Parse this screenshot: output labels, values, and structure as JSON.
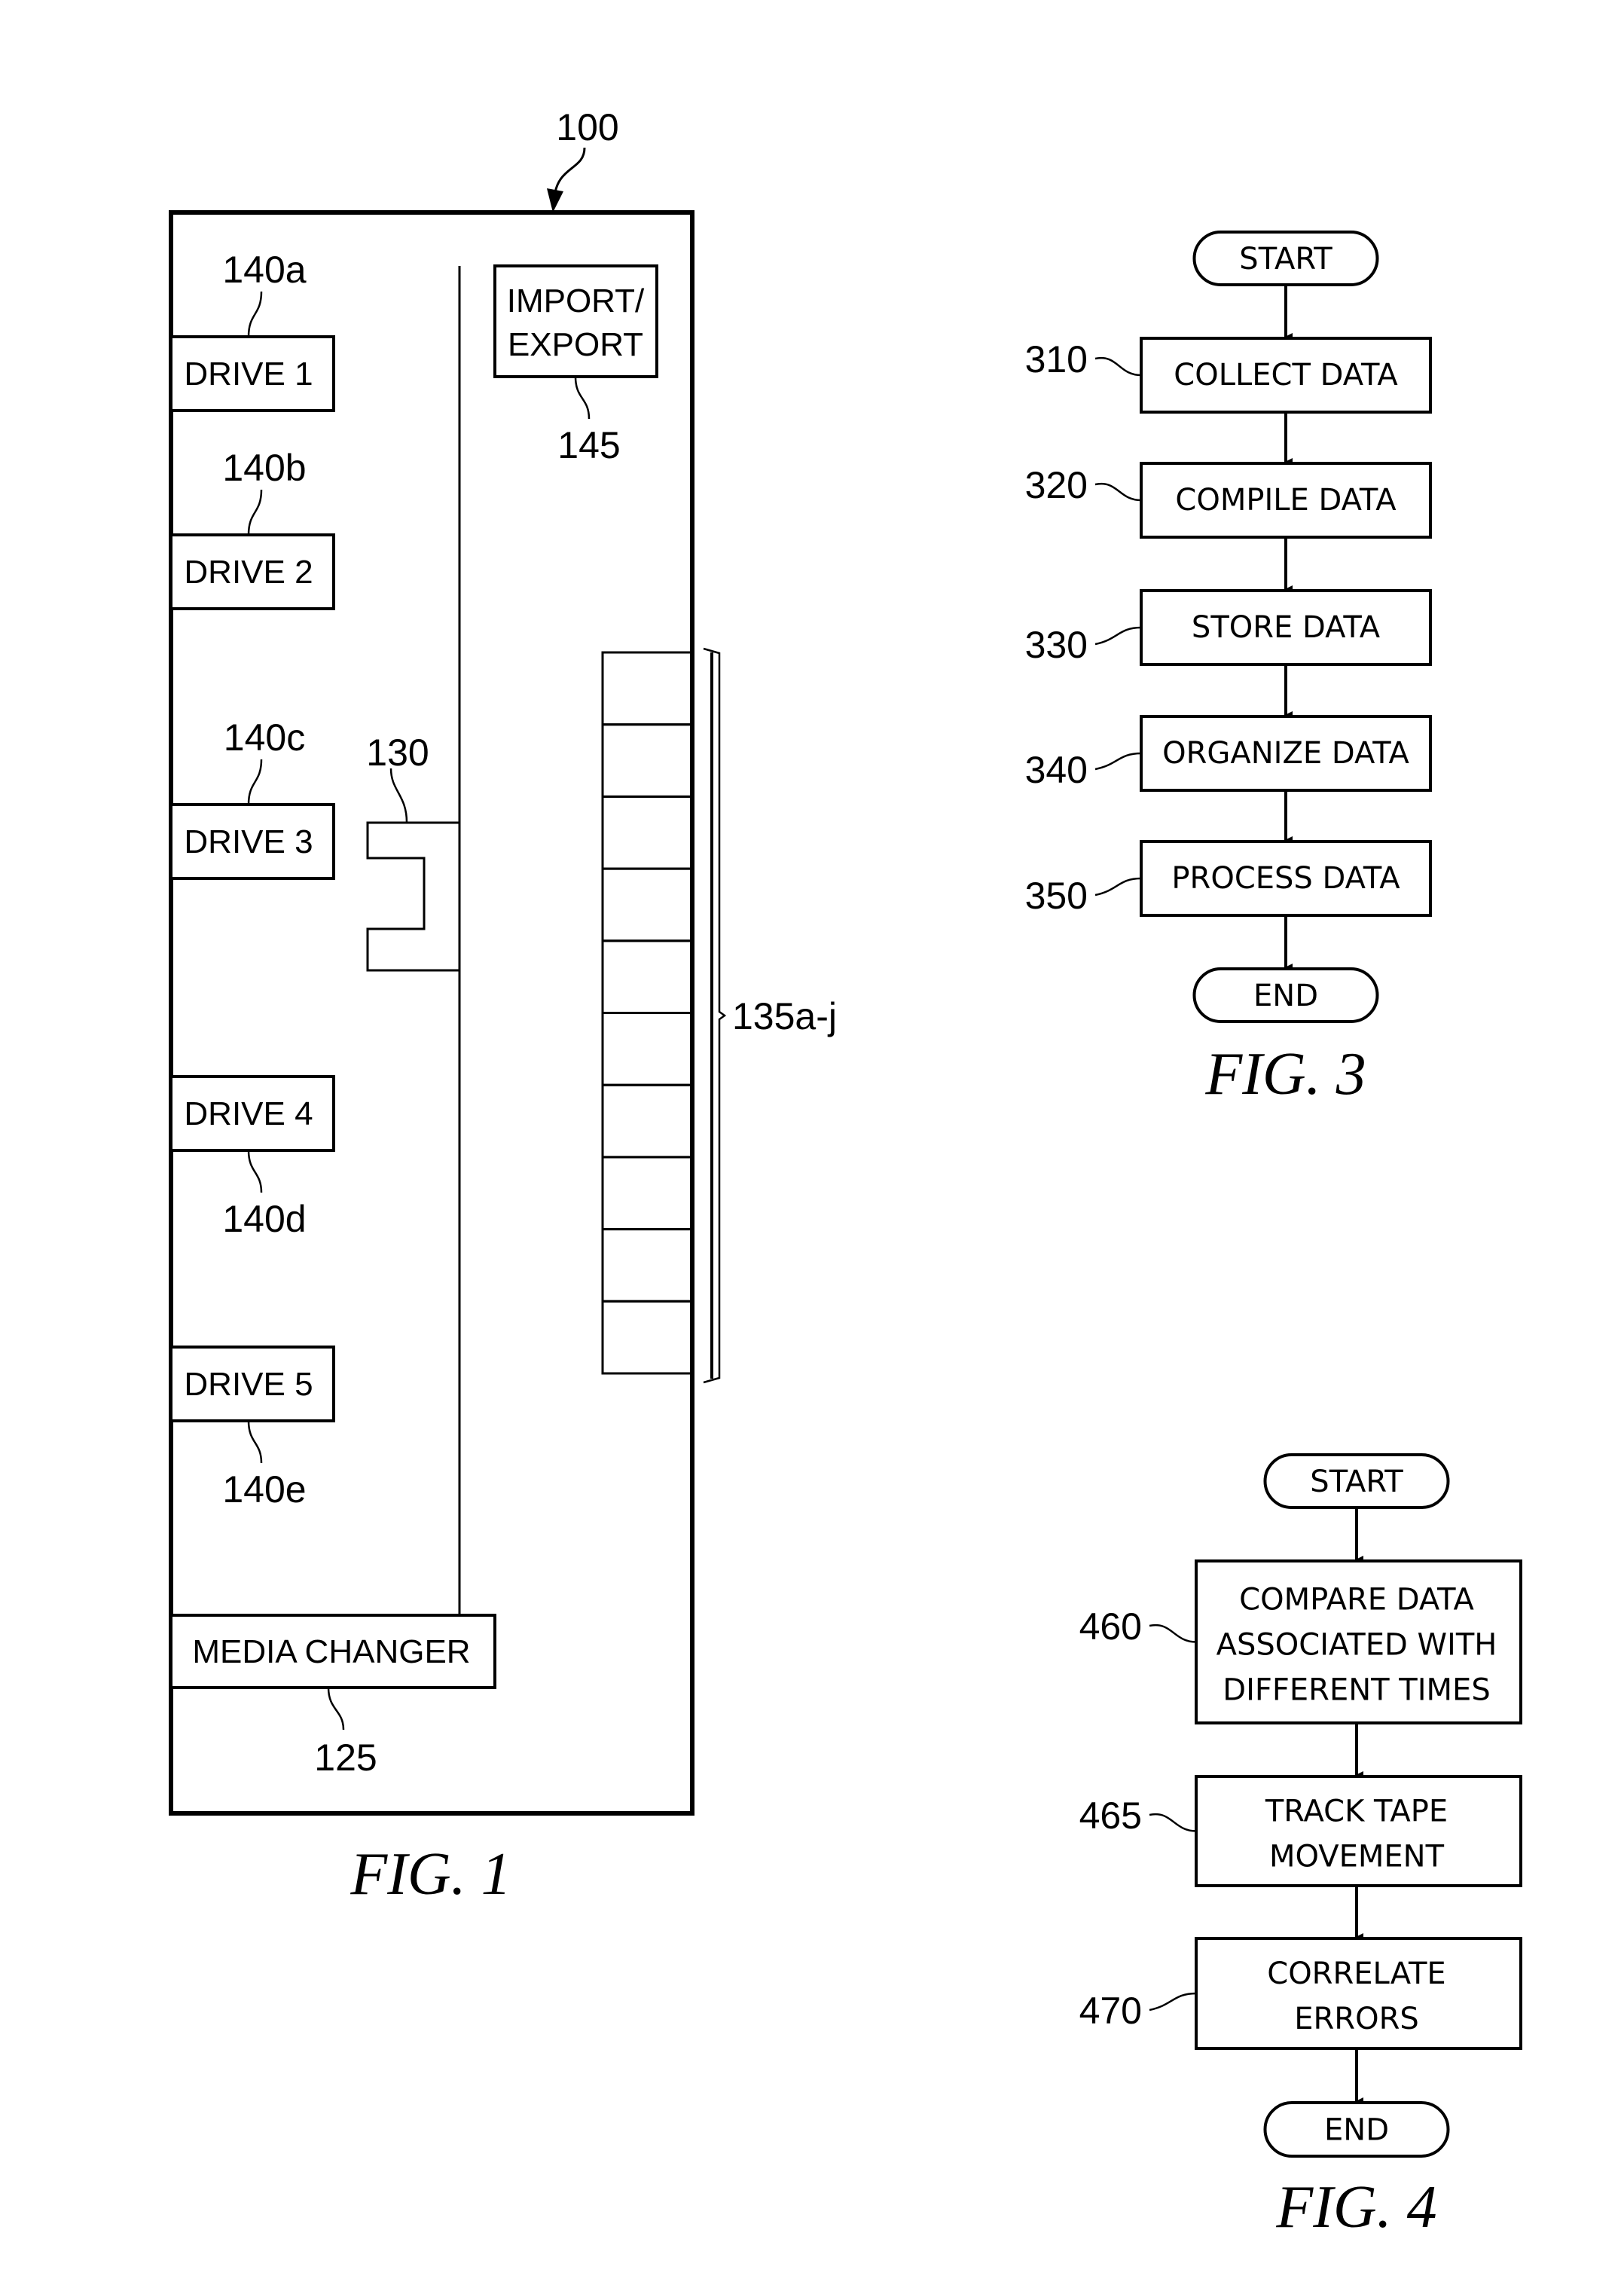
{
  "figure1": {
    "caption": "FIG. 1",
    "system_ref": "100",
    "drives": [
      {
        "label": "DRIVE 1",
        "ref": "140a",
        "ref_position": "above"
      },
      {
        "label": "DRIVE 2",
        "ref": "140b",
        "ref_position": "above"
      },
      {
        "label": "DRIVE 3",
        "ref": "140c",
        "ref_position": "above"
      },
      {
        "label": "DRIVE 4",
        "ref": "140d",
        "ref_position": "below"
      },
      {
        "label": "DRIVE 5",
        "ref": "140e",
        "ref_position": "below"
      }
    ],
    "import_export": {
      "line1": "IMPORT/",
      "line2": "EXPORT",
      "ref": "145"
    },
    "picker_ref": "130",
    "media_changer": {
      "label": "MEDIA CHANGER",
      "ref": "125"
    },
    "slots": {
      "count": 10,
      "ref": "135a-j"
    }
  },
  "figure3": {
    "caption": "FIG. 3",
    "start_label": "START",
    "end_label": "END",
    "steps": [
      {
        "ref": "310",
        "lines": [
          "COLLECT DATA"
        ]
      },
      {
        "ref": "320",
        "lines": [
          "COMPILE DATA"
        ]
      },
      {
        "ref": "330",
        "lines": [
          "STORE DATA"
        ]
      },
      {
        "ref": "340",
        "lines": [
          "ORGANIZE DATA"
        ]
      },
      {
        "ref": "350",
        "lines": [
          "PROCESS DATA"
        ]
      }
    ]
  },
  "figure4": {
    "caption": "FIG. 4",
    "start_label": "START",
    "end_label": "END",
    "steps": [
      {
        "ref": "460",
        "lines": [
          "COMPARE DATA",
          "ASSOCIATED WITH",
          "DIFFERENT TIMES"
        ]
      },
      {
        "ref": "465",
        "lines": [
          "TRACK TAPE",
          "MOVEMENT"
        ]
      },
      {
        "ref": "470",
        "lines": [
          "CORRELATE",
          "ERRORS"
        ]
      }
    ]
  }
}
